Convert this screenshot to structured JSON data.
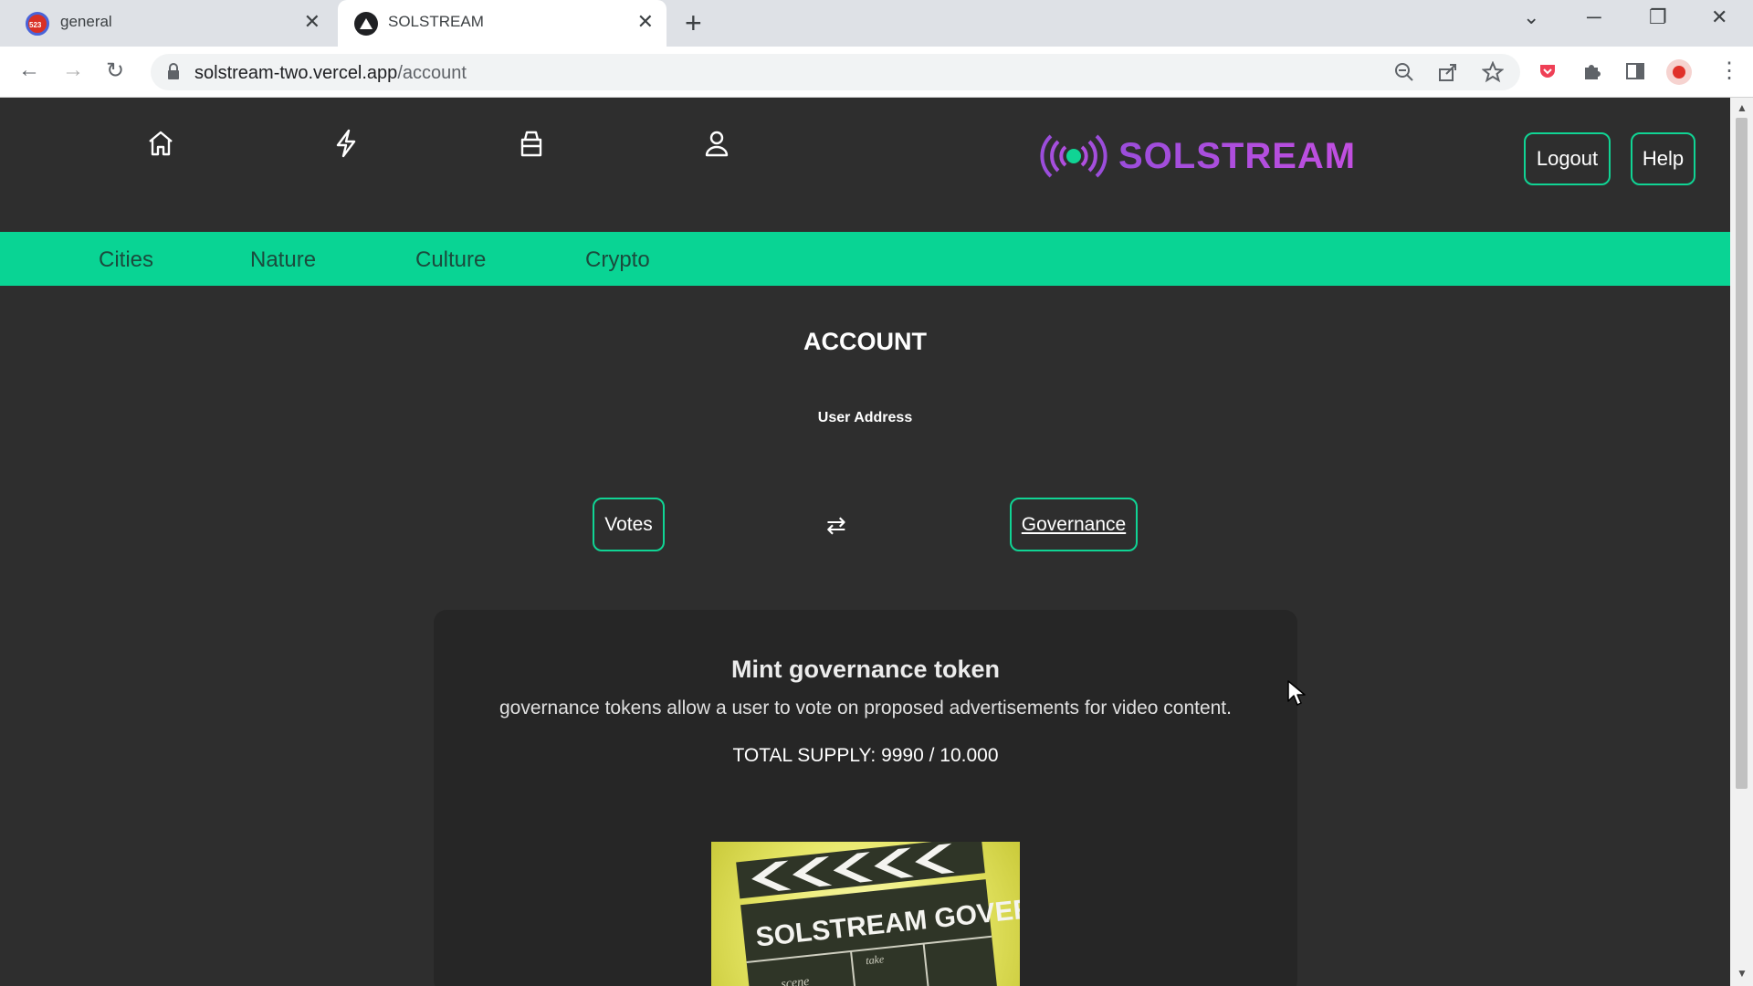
{
  "browser": {
    "tabs": [
      {
        "title": "general",
        "badge": "523",
        "active": false
      },
      {
        "title": "SOLSTREAM",
        "active": true
      }
    ],
    "new_tab_symbol": "+",
    "close_symbol": "✕",
    "url_host": "solstream-two.vercel.app",
    "url_path": "/account",
    "window_controls": {
      "minimize": "─",
      "restore": "❐",
      "close": "✕",
      "tab_search": "⌄"
    }
  },
  "header": {
    "nav_icons": [
      "home-icon",
      "lightning-icon",
      "shopping-bag-icon",
      "user-icon"
    ],
    "logo_text": "SOLSTREAM",
    "logout_label": "Logout",
    "help_label": "Help",
    "accent_color": "#10d494",
    "logo_color": "#b04fdf"
  },
  "categories": [
    "Cities",
    "Nature",
    "Culture",
    "Crypto"
  ],
  "account": {
    "title": "ACCOUNT",
    "user_address_label": "User Address",
    "votes_label": "Votes",
    "governance_label": "Governance",
    "swap_icon": "⇄"
  },
  "card": {
    "title": "Mint governance token",
    "description": "governance tokens allow a user to vote on proposed advertisements for video content.",
    "supply_text": "TOTAL SUPPLY: 9990 / 10.000",
    "image_caption": "SOLSTREAM GOVERNANCE",
    "image_small_text": [
      "scene",
      "take"
    ]
  }
}
